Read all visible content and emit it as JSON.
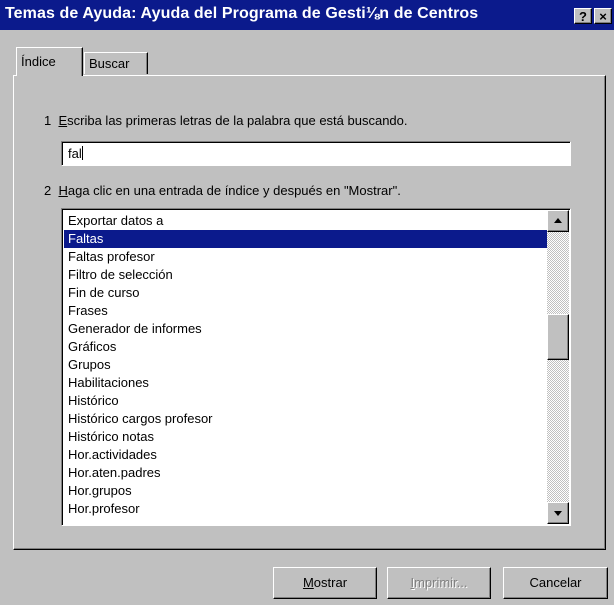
{
  "window": {
    "title": "Temas de Ayuda: Ayuda del Programa de Gesti⅛n de Centros",
    "help_button": "?",
    "close_button": "×"
  },
  "tabs": [
    {
      "label": "Índice",
      "active": true
    },
    {
      "label": "Buscar",
      "active": false
    }
  ],
  "step1": {
    "number": "1",
    "mnemonic": "E",
    "rest": "scriba las primeras letras de la palabra que está buscando."
  },
  "search": {
    "value": "fal"
  },
  "step2": {
    "number": "2",
    "mnemonic": "H",
    "rest": "aga clic en una entrada de índice y después en \"Mostrar\"."
  },
  "index_list": {
    "selected": "Faltas",
    "items": [
      "Exportar datos a",
      "Faltas",
      "Faltas profesor",
      "Filtro de selección",
      "Fin de curso",
      "Frases",
      "Generador de informes",
      "Gráficos",
      "Grupos",
      "Habilitaciones",
      "Histórico",
      "Histórico cargos profesor",
      "Histórico notas",
      "Hor.actividades",
      "Hor.aten.padres",
      "Hor.grupos",
      "Hor.profesor"
    ]
  },
  "buttons": {
    "show": {
      "mnemonic": "M",
      "rest": "ostrar"
    },
    "print": {
      "mnemonic": "I",
      "rest": "mprimir..."
    },
    "cancel": "Cancelar"
  },
  "colors": {
    "selection": "#0b1a8c",
    "face": "#c0c0c0"
  }
}
